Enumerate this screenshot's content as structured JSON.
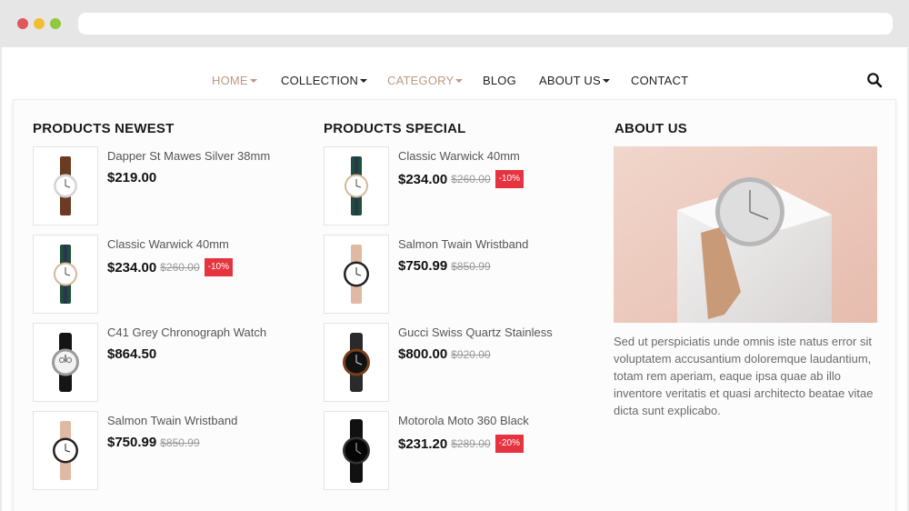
{
  "browser": {
    "url": ""
  },
  "nav": {
    "items": [
      {
        "label": "HOME",
        "dropdown": true,
        "active": true
      },
      {
        "label": "COLLECTION",
        "dropdown": true,
        "active": false
      },
      {
        "label": "CATEGORY",
        "dropdown": true,
        "active": true
      },
      {
        "label": "BLOG",
        "dropdown": false,
        "active": false
      },
      {
        "label": "ABOUT US",
        "dropdown": true,
        "active": false
      },
      {
        "label": "CONTACT",
        "dropdown": false,
        "active": false
      }
    ],
    "search_icon": "search-icon"
  },
  "colors": {
    "accent": "#b99a85",
    "sale_badge": "#e5343f",
    "text_dark": "#111111"
  },
  "newest": {
    "title": "PRODUCTS NEWEST",
    "products": [
      {
        "name": "Dapper St Mawes Silver 38mm",
        "price": "$219.00",
        "old_price": "",
        "discount": ""
      },
      {
        "name": "Classic Warwick 40mm",
        "price": "$234.00",
        "old_price": "$260.00",
        "discount": "-10%"
      },
      {
        "name": "C41 Grey Chronograph Watch",
        "price": "$864.50",
        "old_price": "",
        "discount": ""
      },
      {
        "name": "Salmon Twain Wristband",
        "price": "$750.99",
        "old_price": "$850.99",
        "discount": ""
      }
    ]
  },
  "special": {
    "title": "PRODUCTS SPECIAL",
    "products": [
      {
        "name": "Classic Warwick 40mm",
        "price": "$234.00",
        "old_price": "$260.00",
        "discount": "-10%"
      },
      {
        "name": "Salmon Twain Wristband",
        "price": "$750.99",
        "old_price": "$850.99",
        "discount": ""
      },
      {
        "name": "Gucci Swiss Quartz Stainless",
        "price": "$800.00",
        "old_price": "$920.00",
        "discount": ""
      },
      {
        "name": "Motorola Moto 360 Black",
        "price": "$231.20",
        "old_price": "$289.00",
        "discount": "-20%"
      }
    ]
  },
  "about": {
    "title": "ABOUT US",
    "text": "Sed ut perspiciatis unde omnis iste natus error sit voluptatem accusantium doloremque laudantium, totam rem aperiam, eaque ipsa quae ab illo inventore veritatis et quasi architecto beatae vitae dicta sunt explicabo."
  }
}
